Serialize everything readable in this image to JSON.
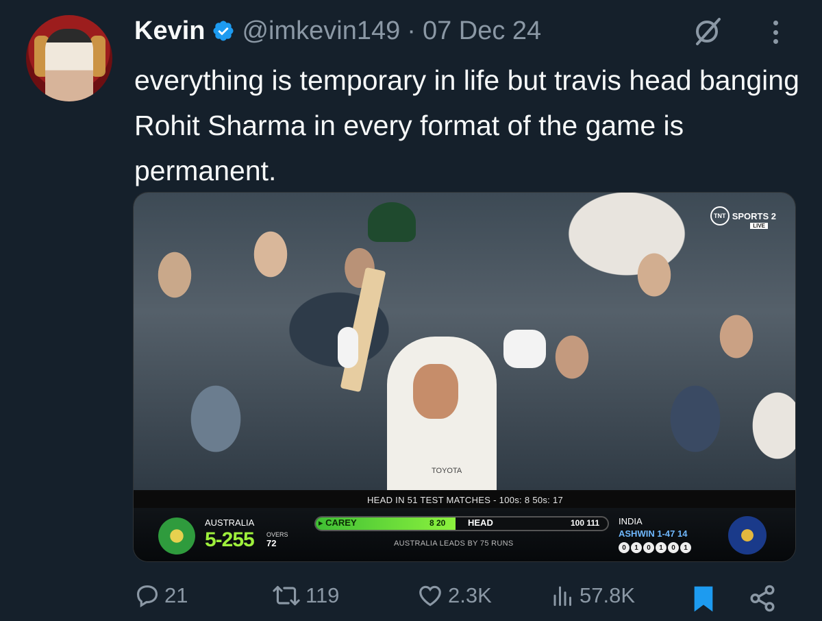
{
  "tweet": {
    "author_name": "Kevin",
    "handle": "@imkevin149",
    "separator": "·",
    "date": "07 Dec 24",
    "text": "everything is temporary in life but travis head banging Rohit Sharma in every format of the game is permanent."
  },
  "media": {
    "sponsor": "TOYOTA",
    "broadcaster": "SPORTS 2",
    "broadcaster_logo": "TNT",
    "live_badge": "LIVE",
    "stat_line": "HEAD IN 51 TEST MATCHES - 100s: 8  50s: 17",
    "scoreboard": {
      "team1": "AUSTRALIA",
      "team1_score": "5-255",
      "overs_label": "OVERS",
      "overs": "72",
      "batter1": "▸ CAREY",
      "batter1_score": "8 20",
      "batter1_share": 0.48,
      "batter2": "HEAD",
      "batter2_score": "100 111",
      "lead": "AUSTRALIA LEADS BY 75 RUNS",
      "team2": "INDIA",
      "bowler": "ASHWIN 1-47 14",
      "balls": [
        "0",
        "1",
        "0",
        "1",
        "0",
        "1"
      ]
    }
  },
  "actions": {
    "replies": "21",
    "retweets": "119",
    "likes": "2.3K",
    "views": "57.8K"
  },
  "colors": {
    "background": "#15202b",
    "muted": "#8b98a5",
    "accent": "#1d9bf0",
    "score_green": "#9ef03c"
  }
}
